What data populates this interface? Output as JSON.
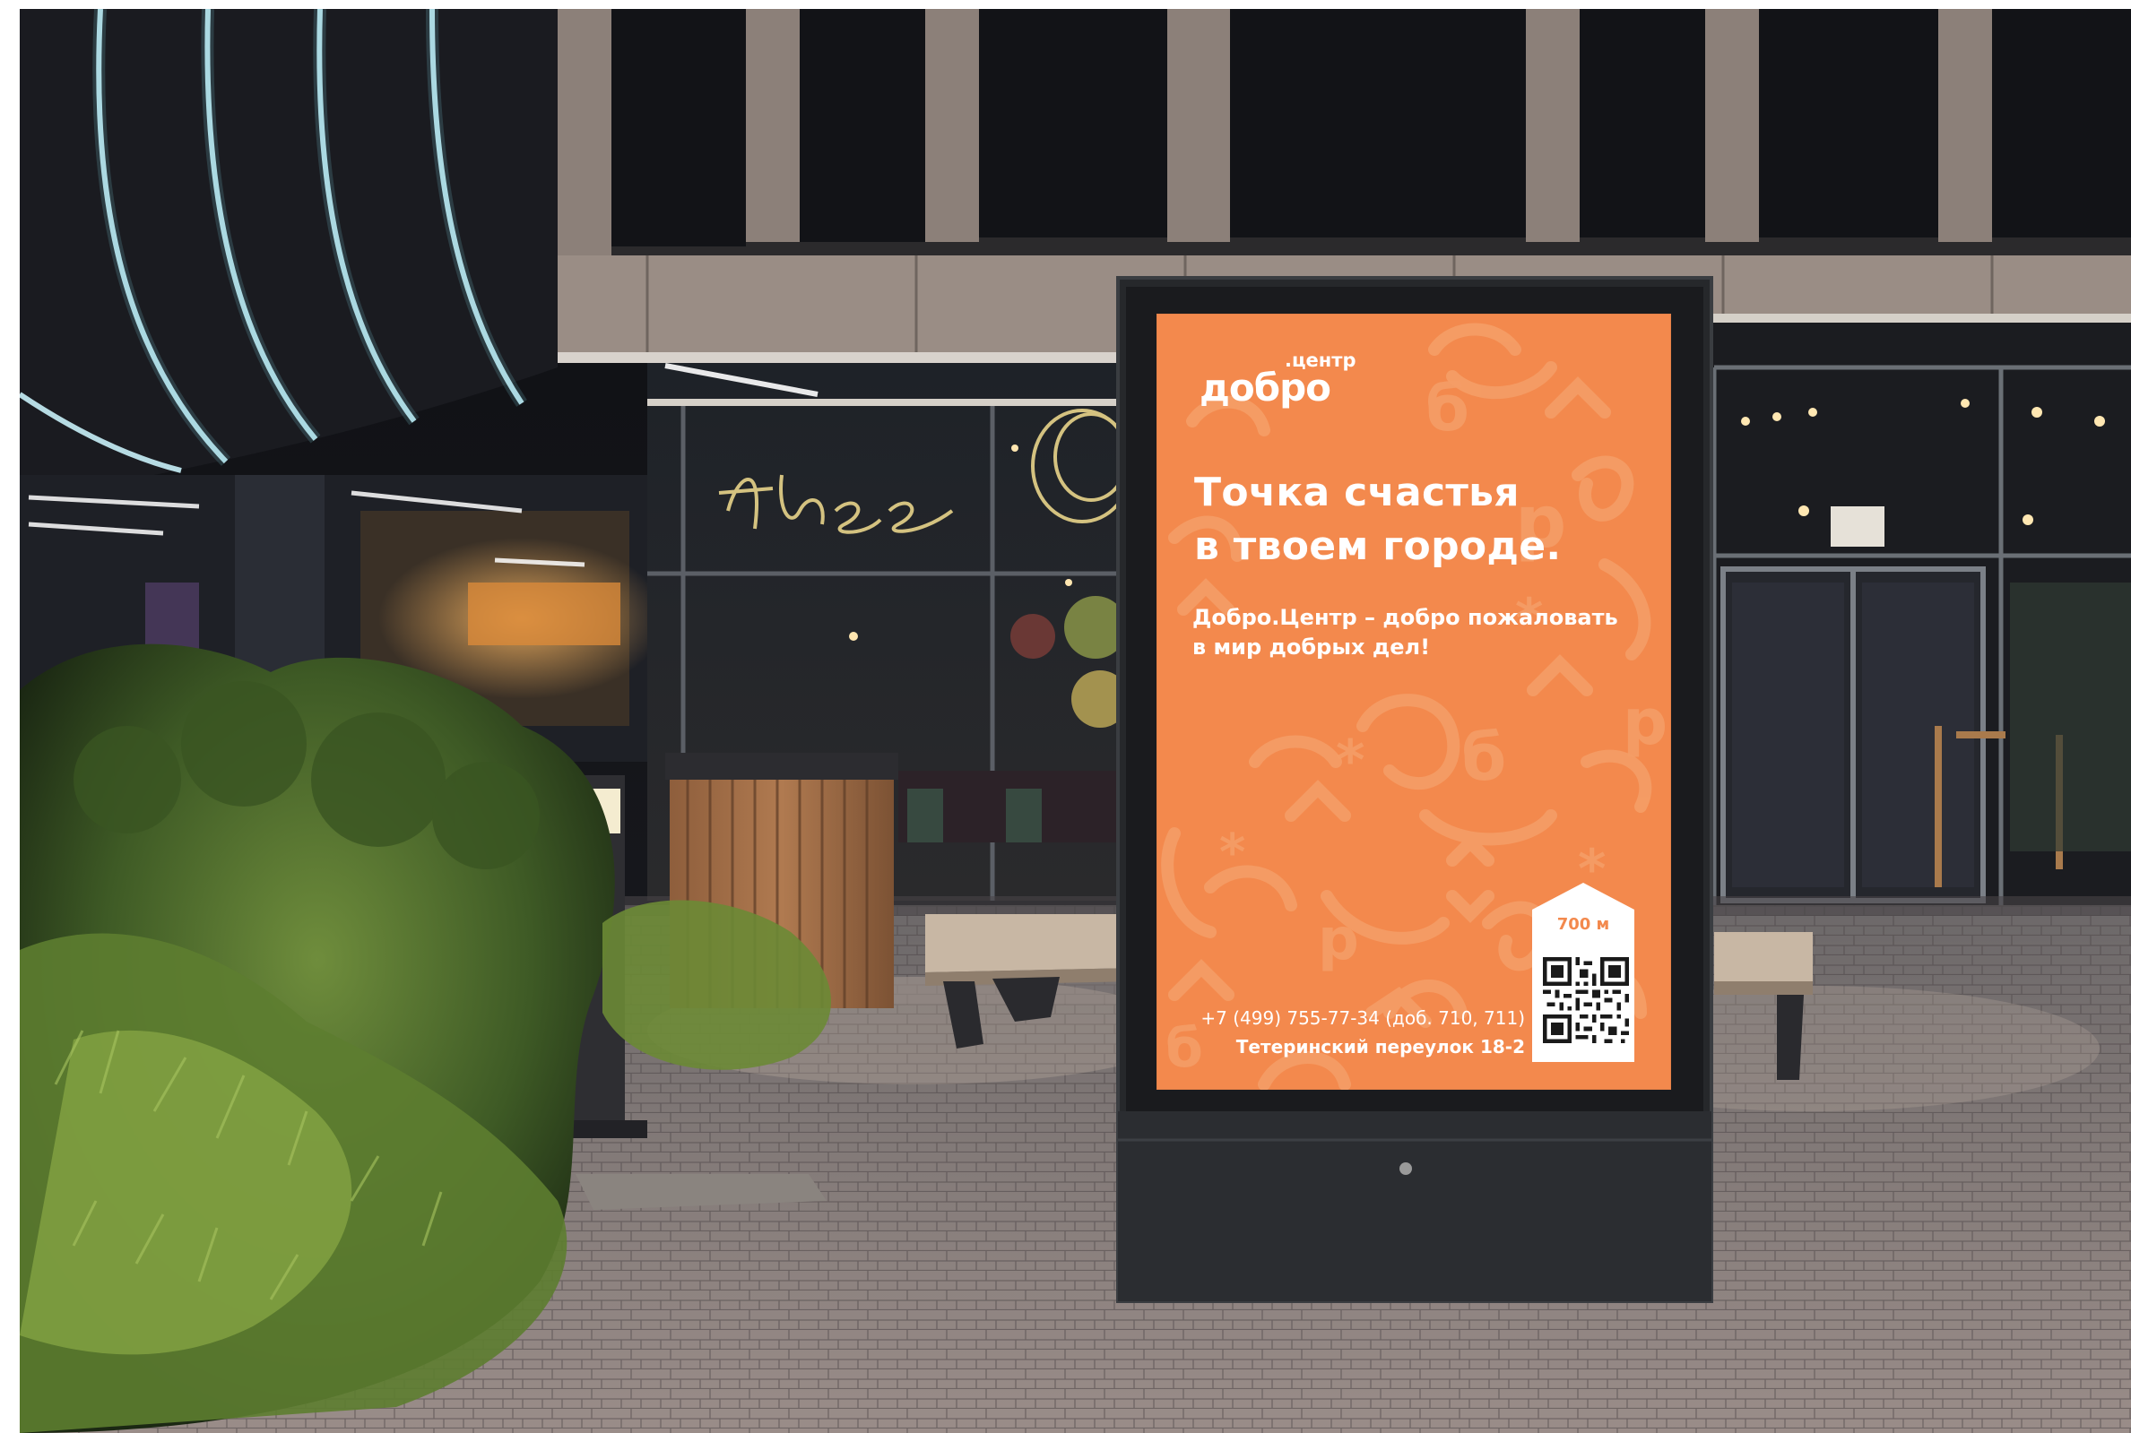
{
  "poster": {
    "logo_main": "добро",
    "logo_sub": ".центр",
    "headline_line1": "Точка счастья",
    "headline_line2": "в твоем городе.",
    "subline_line1": "Добро.Центр – добро пожаловать",
    "subline_line2": "в мир добрых дел!",
    "distance": "700 м",
    "phone": "+7 (499) 755-77-34 (доб. 710, 711)",
    "address": "Тетеринский переулок 18-2",
    "qr_icon": "qr-code-icon",
    "background_color": "#f3894d",
    "text_color": "#ffffff"
  },
  "scene": {
    "setting": "night street",
    "icons": [
      "neon-arches",
      "bench-icon",
      "bollard-lamp-icon",
      "trash-bin-icon",
      "glass-door-icon"
    ]
  }
}
